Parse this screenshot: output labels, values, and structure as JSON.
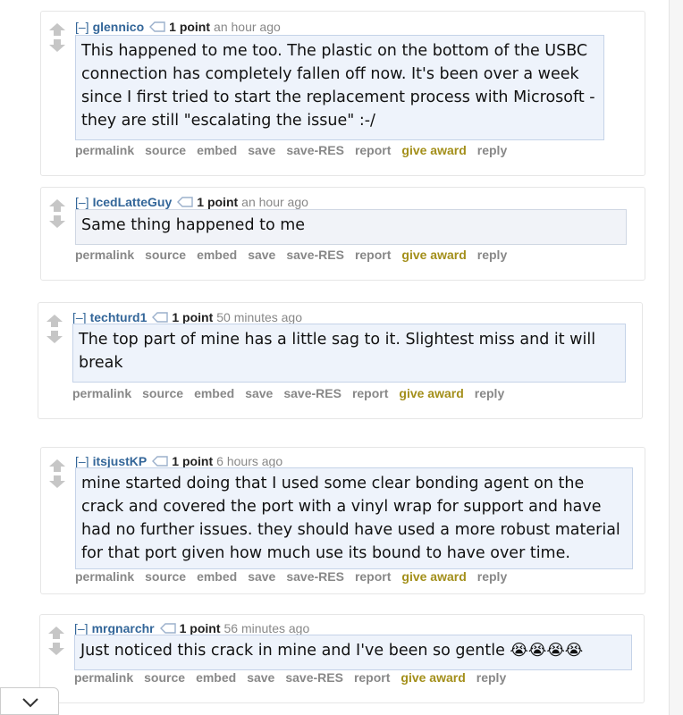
{
  "comments": [
    {
      "toggle": "[–]",
      "author": "glennico",
      "score": "1 point",
      "time": "an hour ago",
      "body": "This happened to me too. The plastic on the bottom of the USBC connection has completely fallen off now. It's been over a week since I first tried to start the replacement process with Microsoft - they are still \"escalating the issue\" :-/"
    },
    {
      "toggle": "[–]",
      "author": "IcedLatteGuy",
      "score": "1 point",
      "time": "an hour ago",
      "body": "Same thing happened to me"
    },
    {
      "toggle": "[–]",
      "author": "techturd1",
      "score": "1 point",
      "time": "50 minutes ago",
      "body": "The top part of mine has a little sag to it. Slightest miss and it will break"
    },
    {
      "toggle": "[–]",
      "author": "itsjustKP",
      "score": "1 point",
      "time": "6 hours ago",
      "body": "mine started doing that I used some clear bonding agent on the crack and covered the port with a vinyl wrap for support and have had no further issues. they should have used a more robust material for that port given how much use its bound to have over time."
    },
    {
      "toggle": "[–]",
      "author": "mrgnarchr",
      "score": "1 point",
      "time": "56 minutes ago",
      "body": "Just noticed this crack in mine and I've been so gentle 😭😭😭😭"
    }
  ],
  "actions": {
    "permalink": "permalink",
    "source": "source",
    "embed": "embed",
    "save": "save",
    "save_res": "save-RES",
    "report": "report",
    "give_award": "give award",
    "reply": "reply"
  },
  "colors": {
    "author": "#336699",
    "award": "#a38f1a",
    "body_bg": "#eef3fb",
    "body_border": "#c5d3e8"
  },
  "icons": {
    "upvote": "upvote-arrow-icon",
    "downvote": "downvote-arrow-icon",
    "flair": "tag-icon",
    "collapse": "chevron-down-icon"
  }
}
